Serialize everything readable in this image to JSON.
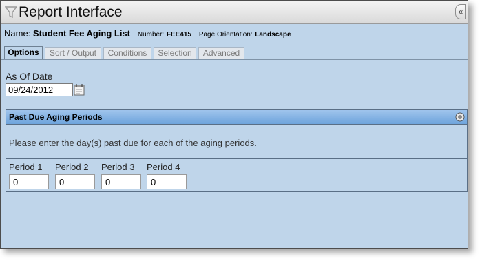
{
  "window": {
    "title": "Report Interface"
  },
  "report": {
    "name_label": "Name:",
    "name": "Student Fee Aging List",
    "number_label": "Number:",
    "number": "FEE415",
    "orientation_label": "Page Orientation:",
    "orientation": "Landscape"
  },
  "tabs": [
    {
      "label": "Options"
    },
    {
      "label": "Sort / Output"
    },
    {
      "label": "Conditions"
    },
    {
      "label": "Selection"
    },
    {
      "label": "Advanced"
    }
  ],
  "active_tab": "Options",
  "options": {
    "as_of_label": "As Of Date",
    "as_of_value": "09/24/2012"
  },
  "aging_panel": {
    "title": "Past Due Aging Periods",
    "description": "Please enter the day(s) past due for each of the aging periods.",
    "periods": [
      {
        "label": "Period 1",
        "value": "0"
      },
      {
        "label": "Period 2",
        "value": "0"
      },
      {
        "label": "Period 3",
        "value": "0"
      },
      {
        "label": "Period 4",
        "value": "0"
      }
    ]
  },
  "icons": {
    "title_icon": "funnel-icon",
    "collapse": "double-chevron-left-icon",
    "calendar": "calendar-icon",
    "panel_toggle": "circle-toggle-icon"
  },
  "colors": {
    "window_bg": "#bfd5ea",
    "panel_header": "#86b3e4"
  }
}
